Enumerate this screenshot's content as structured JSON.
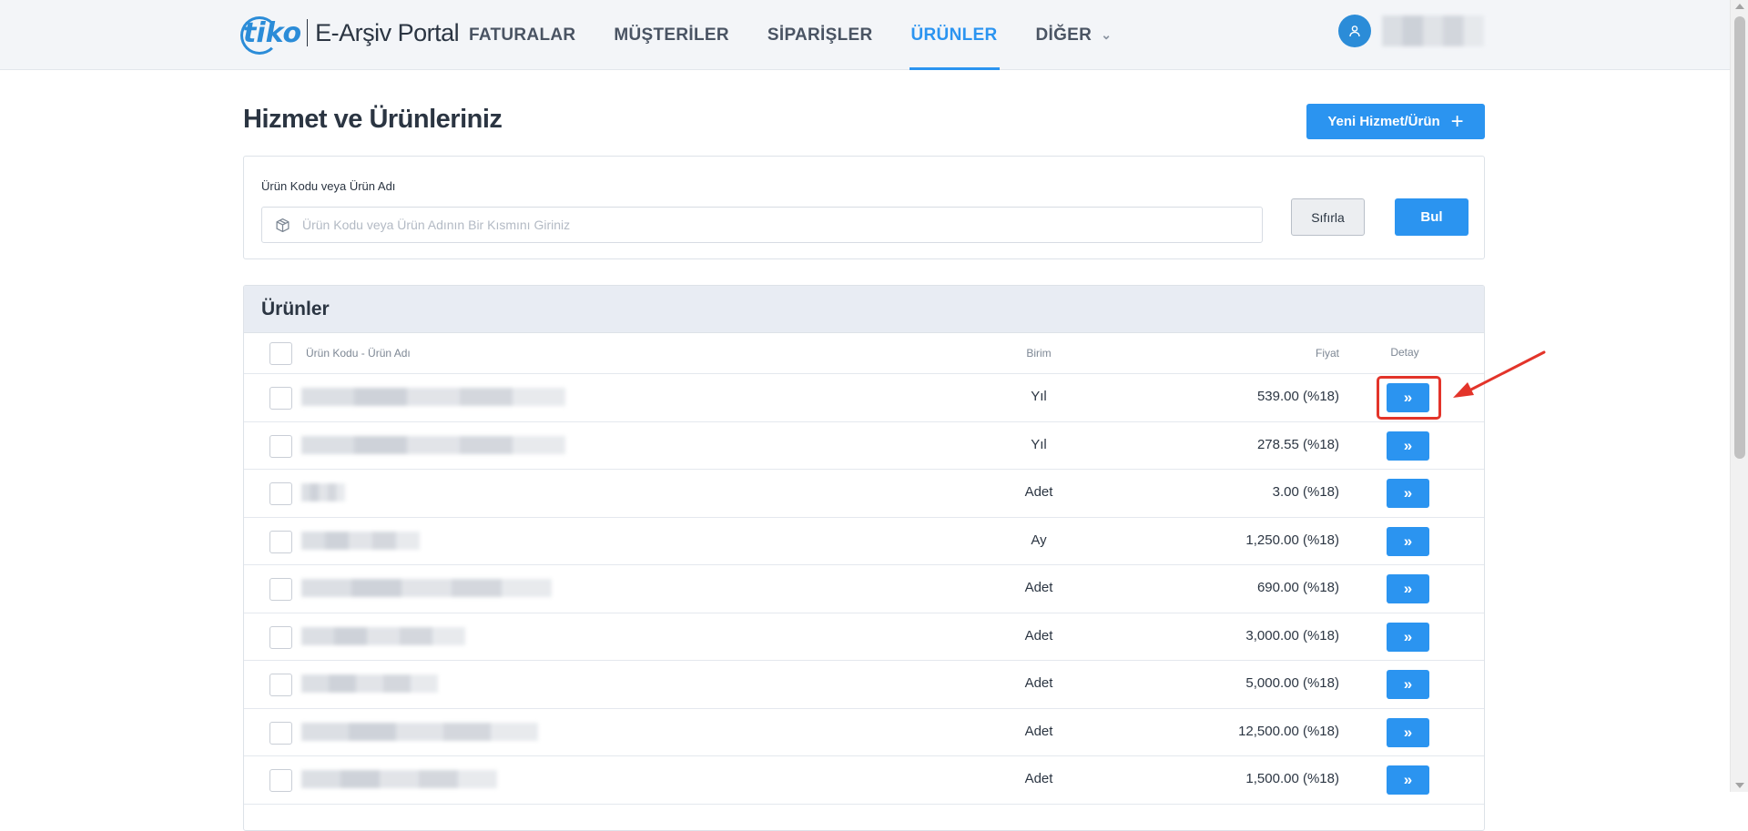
{
  "brand": {
    "logo_mark": "tiko",
    "portal_name": "E-Arşiv Portal"
  },
  "nav": [
    {
      "label": "FATURALAR",
      "active": false
    },
    {
      "label": "MÜŞTERİLER",
      "active": false
    },
    {
      "label": "SİPARİŞLER",
      "active": false
    },
    {
      "label": "ÜRÜNLER",
      "active": true
    },
    {
      "label": "DİĞER",
      "active": false,
      "has_dropdown": true
    }
  ],
  "user": {
    "icon": "user-icon"
  },
  "page": {
    "title": "Hizmet ve Ürünleriniz",
    "new_button": "Yeni Hizmet/Ürün"
  },
  "filter": {
    "label": "Ürün Kodu veya Ürün Adı",
    "placeholder": "Ürün Kodu veya Ürün Adının Bir Kısmını Giriniz",
    "value": "",
    "reset_button": "Sıfırla",
    "find_button": "Bul"
  },
  "table": {
    "title": "Ürünler",
    "columns": {
      "name": "Ürün Kodu - Ürün Adı",
      "unit": "Birim",
      "price": "Fiyat",
      "detail": "Detay"
    },
    "rows": [
      {
        "unit": "Yıl",
        "price": "539.00 (%18)"
      },
      {
        "unit": "Yıl",
        "price": "278.55 (%18)"
      },
      {
        "unit": "Adet",
        "price": "3.00 (%18)"
      },
      {
        "unit": "Ay",
        "price": "1,250.00 (%18)"
      },
      {
        "unit": "Adet",
        "price": "690.00 (%18)"
      },
      {
        "unit": "Adet",
        "price": "3,000.00 (%18)"
      },
      {
        "unit": "Adet",
        "price": "5,000.00 (%18)"
      },
      {
        "unit": "Adet",
        "price": "12,500.00 (%18)"
      },
      {
        "unit": "Adet",
        "price": "1,500.00 (%18)"
      }
    ],
    "detail_glyph": "»"
  },
  "annotation": {
    "color": "#e3342a"
  },
  "colors": {
    "accent": "#2b94f0",
    "header_bg": "#f3f5f8",
    "table_head_bg": "#e8ecf3"
  }
}
